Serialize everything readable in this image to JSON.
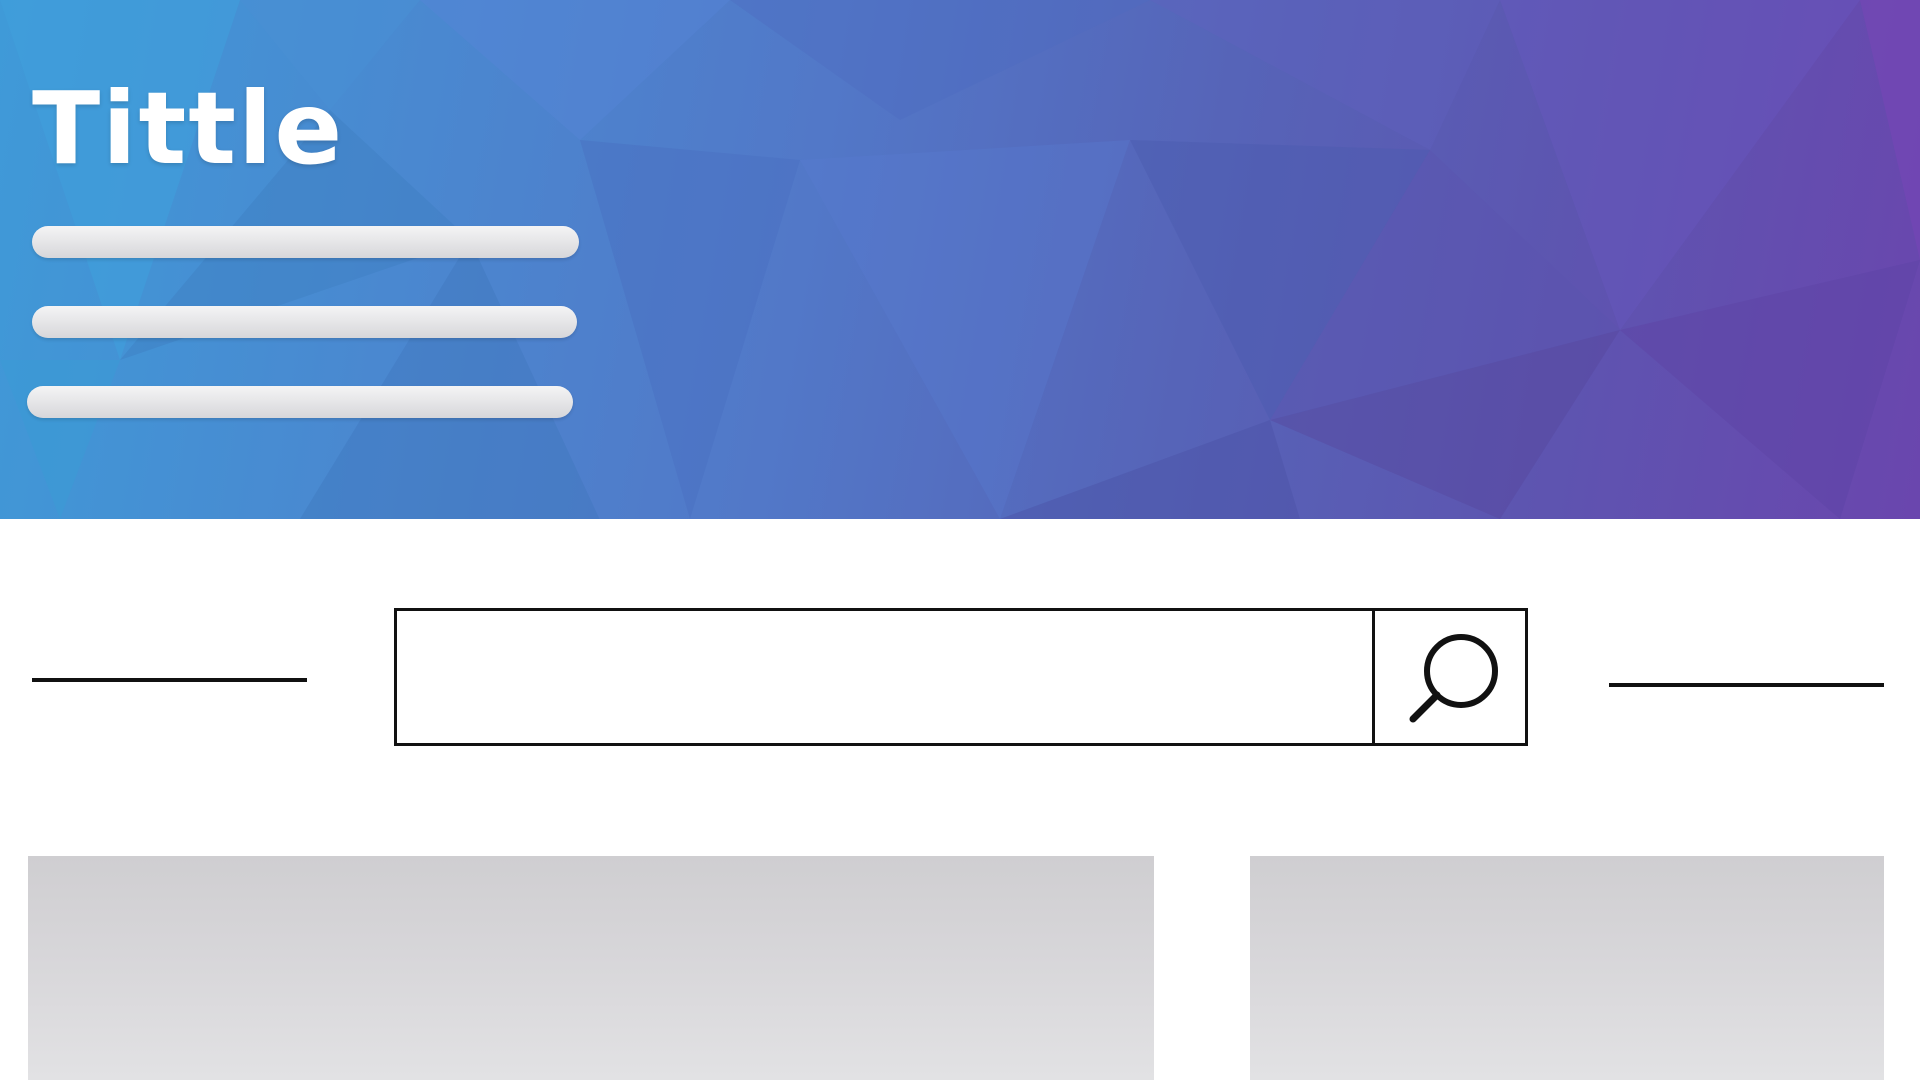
{
  "hero": {
    "title": "Tittle",
    "text_line_count": 3
  },
  "search": {
    "value": "",
    "placeholder": "",
    "button_icon": "search-icon"
  },
  "colors": {
    "hero_gradient_start": "#3f9ad8",
    "hero_gradient_end": "#6a46ae",
    "outline": "#111111",
    "placeholder_line": "#e0e0e3",
    "card_fill": "#d6d5d8"
  }
}
